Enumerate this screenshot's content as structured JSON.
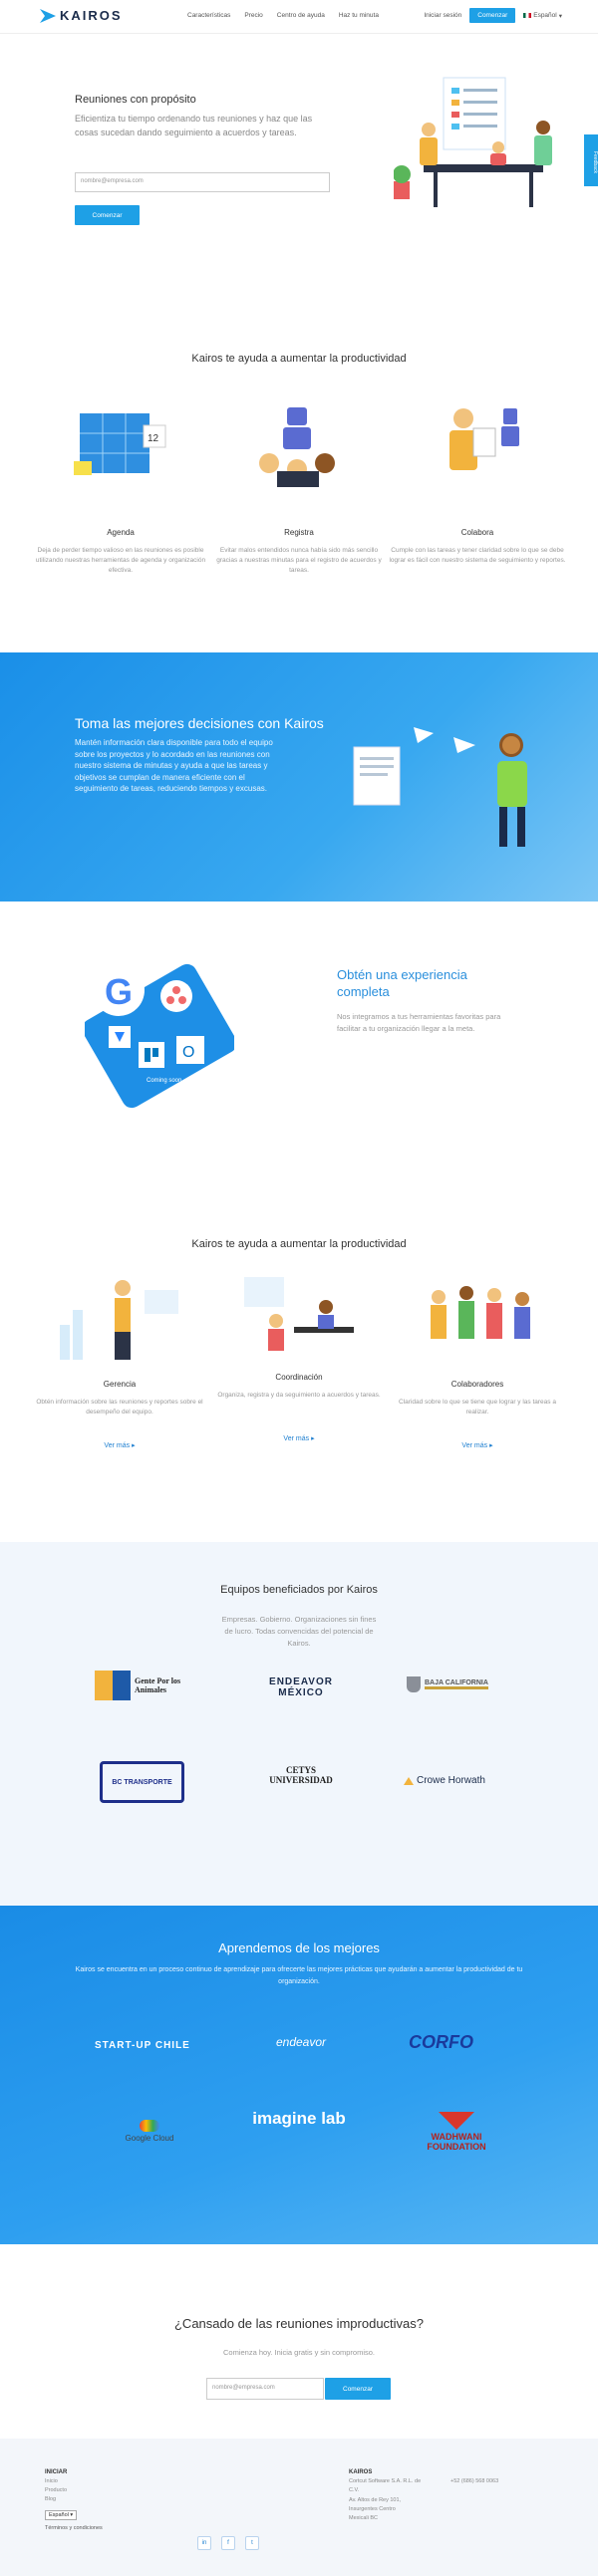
{
  "brand": {
    "name": "KAIROS",
    "accent": "#1ea0e6",
    "dark": "#1a2b4a"
  },
  "nav": {
    "links": [
      "Características",
      "Precio",
      "Centro de ayuda",
      "Haz tu minuta"
    ],
    "login": "Iniciar sesión",
    "cta": "Comenzar",
    "lang": "Español"
  },
  "feedback_tab": "Feedback",
  "hero": {
    "title": "Reuniones con propósito",
    "subtitle": "Eficientiza tu tiempo ordenando tus reuniones y haz que las cosas sucedan dando seguimiento a acuerdos y tareas.",
    "email_placeholder": "nombre@empresa.com",
    "button": "Comenzar"
  },
  "productivity": {
    "title": "Kairos te ayuda a aumentar la productividad",
    "columns": [
      {
        "title": "Agenda",
        "text": "Deja de perder tiempo valioso en las reuniones es posible utilizando nuestras herramientas de agenda y organización efectiva."
      },
      {
        "title": "Registra",
        "text": "Evitar malos entendidos nunca había sido más sencillo gracias a nuestras minutas para el registro de acuerdos y tareas."
      },
      {
        "title": "Colabora",
        "text": "Cumple con las tareas y tener claridad sobre lo que se debe lograr es fácil con nuestro sistema de seguimiento y reportes."
      }
    ]
  },
  "decisions": {
    "title": "Toma las mejores decisiones con Kairos",
    "text": "Mantén información clara disponible para todo el equipo sobre los proyectos y lo acordado en las reuniones con nuestro sistema de minutas y ayuda a que las tareas y objetivos se cumplan de manera eficiente con el seguimiento de tareas, reduciendo tiempos y excusas."
  },
  "complete": {
    "title": "Obtén una experiencia completa",
    "text": "Nos integramos a tus herramientas favoritas para facilitar a tu organización llegar a la meta.",
    "badge": "Coming soon"
  },
  "productivity2": {
    "title": "Kairos te ayuda a aumentar la productividad",
    "columns": [
      {
        "title": "Gerencia",
        "text": "Obtén información sobre las reuniones y reportes sobre el desempeño del equipo.",
        "more": "Ver más"
      },
      {
        "title": "Coordinación",
        "text": "Organiza, registra y da seguimiento a acuerdos y tareas.",
        "more": "Ver más"
      },
      {
        "title": "Colaboradores",
        "text": "Claridad sobre lo que se tiene que lograr y las tareas a realizar.",
        "more": "Ver más"
      }
    ]
  },
  "teams": {
    "title": "Equipos beneficiados por Kairos",
    "subtitle": "Empresas. Gobierno. Organizaciones sin fines de lucro. Todas convencidas del potencial de Kairos.",
    "logos": [
      "Gente Por los Animales",
      "ENDEAVOR MÉXICO",
      "BAJA CALIFORNIA",
      "BC TRANSPORTE",
      "CETYS UNIVERSIDAD",
      "Crowe Horwath"
    ]
  },
  "learn": {
    "title": "Aprendemos de los mejores",
    "text": "Kairos se encuentra en un proceso continuo de aprendizaje para ofrecerte las mejores prácticas que ayudarán a aumentar la productividad de tu organización.",
    "logos": [
      "START-UP CHILE",
      "endeavor",
      "CORFO",
      "Google Cloud",
      "imagine lab",
      "WADHWANI FOUNDATION"
    ]
  },
  "cta": {
    "title": "¿Cansado de las reuniones improductivas?",
    "subtitle": "Comienza hoy. Inicia gratis y sin compromiso.",
    "email_placeholder": "nombre@empresa.com",
    "button": "Comenzar"
  },
  "footer": {
    "col1_head": "INICIAR",
    "col1_items": [
      "Inicio",
      "Producto",
      "Blog"
    ],
    "lang": "Español",
    "terms": "Términos y condiciones",
    "col2_head": "KAIROS",
    "col2_items": [
      "Cortcut Software S.A. R.L. de C.V.",
      "Av. Altos de Rey 101,",
      "Insurgentes Centro",
      "Mexicali BC"
    ],
    "phone": "+52 (686) 568 0063",
    "social": [
      "in",
      "f",
      "t"
    ]
  }
}
